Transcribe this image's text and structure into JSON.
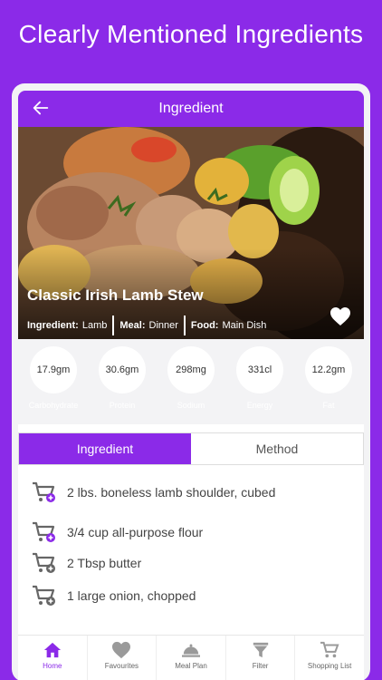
{
  "headline": "Clearly Mentioned Ingredients",
  "appbar": {
    "title": "Ingredient",
    "back_icon": "arrow-left-icon"
  },
  "dish": {
    "title": "Classic Irish Lamb Stew",
    "meta": [
      {
        "key": "Ingredient:",
        "value": "Lamb"
      },
      {
        "key": "Meal:",
        "value": "Dinner"
      },
      {
        "key": "Food:",
        "value": "Main Dish"
      }
    ],
    "favorite_icon": "heart-icon"
  },
  "nutrition": [
    {
      "value": "17.9gm",
      "label": "Carbohydrate"
    },
    {
      "value": "30.6gm",
      "label": "Protein"
    },
    {
      "value": "298mg",
      "label": "Sodium"
    },
    {
      "value": "331cl",
      "label": "Energy"
    },
    {
      "value": "12.2gm",
      "label": "Fat"
    }
  ],
  "tabs": {
    "ingredient": "Ingredient",
    "method": "Method"
  },
  "ingredients": [
    "2 lbs. boneless lamb shoulder, cubed",
    "3/4 cup all-purpose flour",
    "2 Tbsp butter",
    "1 large onion, chopped"
  ],
  "bottom_nav": [
    {
      "label": "Home",
      "icon": "home-icon"
    },
    {
      "label": "Favourites",
      "icon": "heart-icon"
    },
    {
      "label": "Meal Plan",
      "icon": "cloche-icon"
    },
    {
      "label": "Filter",
      "icon": "funnel-icon"
    },
    {
      "label": "Shopping List",
      "icon": "cart-icon"
    }
  ],
  "colors": {
    "accent": "#8b2ae8",
    "text": "#444444",
    "white": "#ffffff"
  }
}
